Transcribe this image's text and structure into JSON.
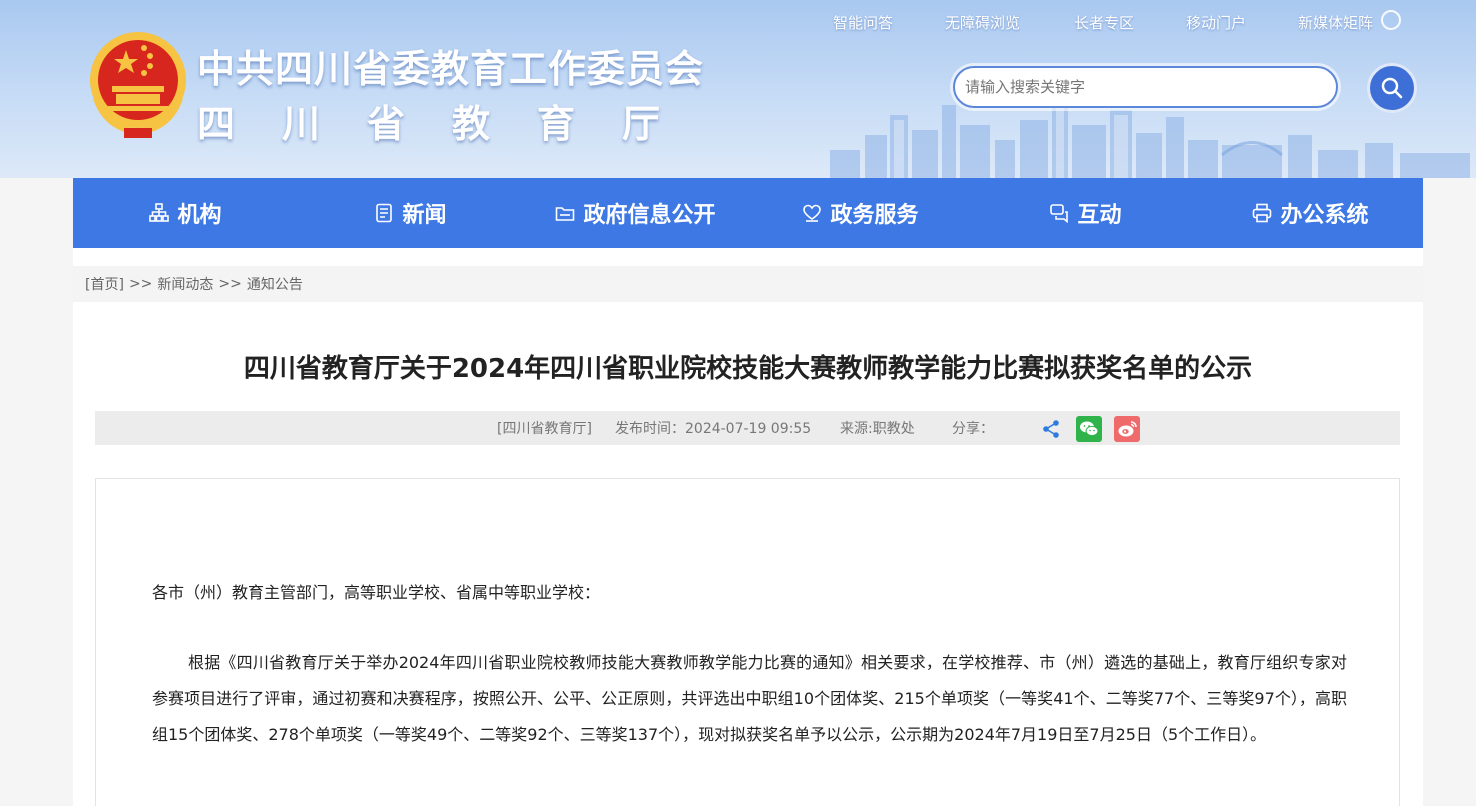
{
  "header": {
    "org_line1": "中共四川省委教育工作委员会",
    "org_line2": "四川省教育厅",
    "top_links": [
      "智能问答",
      "无障碍浏览",
      "长者专区",
      "移动门户",
      "新媒体矩阵"
    ],
    "search_placeholder": "请输入搜索关键字"
  },
  "nav": {
    "items": [
      {
        "label": "机构",
        "icon": "org-chart-icon"
      },
      {
        "label": "新闻",
        "icon": "news-icon"
      },
      {
        "label": "政府信息公开",
        "icon": "folder-open-icon"
      },
      {
        "label": "政务服务",
        "icon": "heart-hand-icon"
      },
      {
        "label": "互动",
        "icon": "chat-icon"
      },
      {
        "label": "办公系统",
        "icon": "printer-icon"
      }
    ]
  },
  "breadcrumb": {
    "home": "[首页]",
    "sep": ">>",
    "level1": "新闻动态",
    "level2": "通知公告"
  },
  "article": {
    "title": "四川省教育厅关于2024年四川省职业院校技能大赛教师教学能力比赛拟获奖名单的公示",
    "meta_source": "[四川省教育厅]",
    "meta_time": "发布时间：2024-07-19 09:55",
    "meta_from": "来源:职教处",
    "meta_share": "分享：",
    "share_icons": [
      "share-icon",
      "wechat-icon",
      "weibo-icon"
    ],
    "greeting": "各市（州）教育主管部门，高等职业学校、省属中等职业学校：",
    "paragraph": "根据《四川省教育厅关于举办2024年四川省职业院校教师技能大赛教师教学能力比赛的通知》相关要求，在学校推荐、市（州）遴选的基础上，教育厅组织专家对参赛项目进行了评审，通过初赛和决赛程序，按照公开、公平、公正原则，共评选出中职组10个团体奖、215个单项奖（一等奖41个、二等奖77个、三等奖97个），高职组15个团体奖、278个单项奖（一等奖49个、二等奖92个、三等奖137个），现对拟获奖名单予以公示，公示期为2024年7月19日至7月25日（5个工作日）。"
  },
  "colors": {
    "nav_bg": "#3d78e4",
    "header_sky": "#a9c8f0",
    "search_button": "#3e6fd6",
    "wechat": "#2fb34a",
    "weibo": "#ef6b6b"
  }
}
